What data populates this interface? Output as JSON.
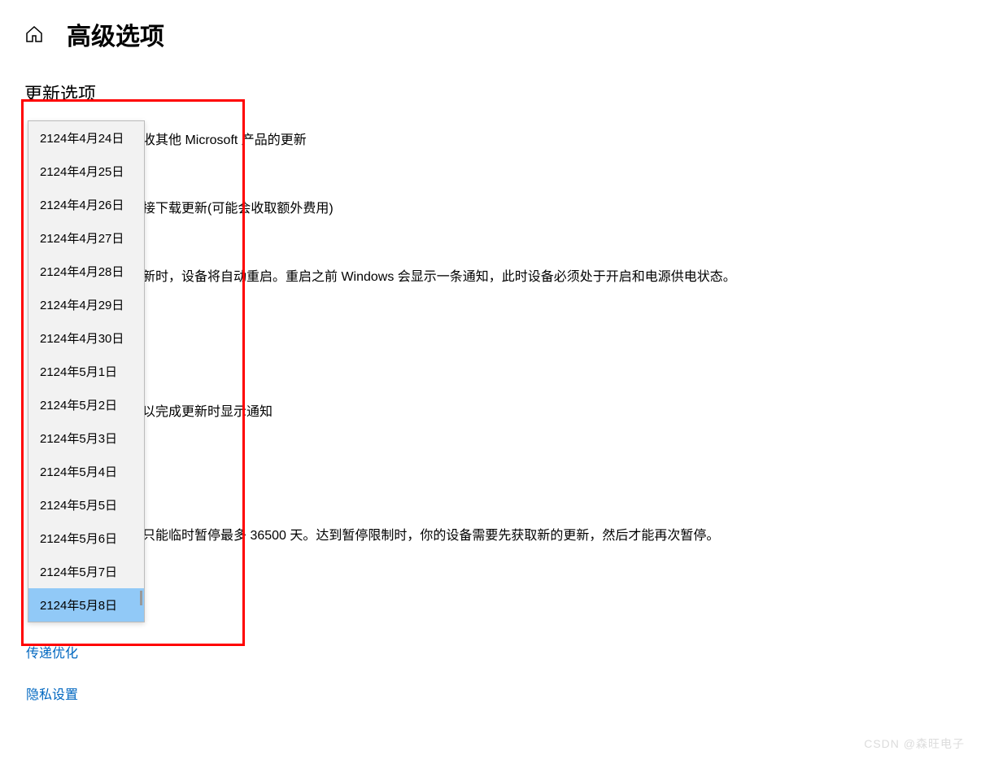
{
  "header": {
    "title": "高级选项"
  },
  "sections": {
    "update_options_heading": "更新选项",
    "receive_other_products": "收其他 Microsoft 产品的更新",
    "metered_connection": "接下载更新(可能会收取额外费用)",
    "auto_restart": "新时，设备将自动重启。重启之前 Windows 会显示一条通知，此时设备必须处于开启和电源供电状态。",
    "restart_notify": "以完成更新时显示通知",
    "pause_updates": "只能临时暂停最多 36500 天。达到暂停限制时，你的设备需要先获取新的更新，然后才能再次暂停。"
  },
  "links": {
    "delivery_optimization": "传递优化",
    "privacy_settings": "隐私设置"
  },
  "dropdown": {
    "items": [
      "2124年4月24日",
      "2124年4月25日",
      "2124年4月26日",
      "2124年4月27日",
      "2124年4月28日",
      "2124年4月29日",
      "2124年4月30日",
      "2124年5月1日",
      "2124年5月2日",
      "2124年5月3日",
      "2124年5月4日",
      "2124年5月5日",
      "2124年5月6日",
      "2124年5月7日",
      "2124年5月8日"
    ],
    "selected_index": 14
  },
  "watermark": "CSDN @森旺电子"
}
